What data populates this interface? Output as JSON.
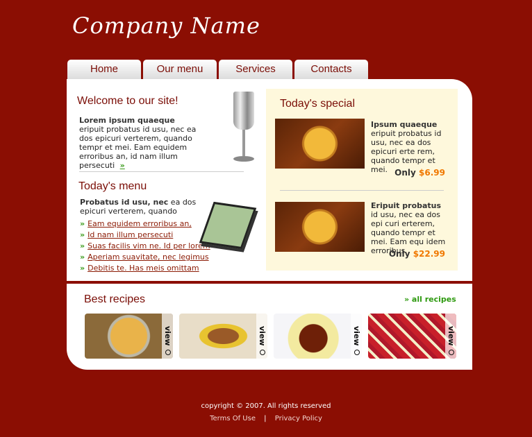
{
  "logo": "Company Name",
  "nav": [
    {
      "label": "Home"
    },
    {
      "label": "Our menu"
    },
    {
      "label": "Services"
    },
    {
      "label": "Contacts"
    }
  ],
  "welcome": {
    "title": "Welcome to our site!",
    "bold": "Lorem ipsum quaeque",
    "text": "eripuit probatus id usu, nec ea dos epicuri verterem, quando tempr et mei. Eam equidem erroribus an, id nam illum persecuti",
    "more": "»"
  },
  "menu": {
    "title": "Today's menu",
    "bold": "Probatus id usu, nec",
    "text": " ea dos epicuri verterem, quando",
    "links": [
      "Eam equidem erroribus an,",
      "Id nam illum persecuti",
      "Suas facilis vim ne. Id per lorem",
      "Aperiam suavitate, nec legimus",
      "Debitis te. Has meis omittam"
    ],
    "bullet": "»"
  },
  "special": {
    "title": "Today's special",
    "items": [
      {
        "name": "Ipsum quaeque",
        "text": "eripuit probatus id usu, nec ea dos epicuri erte rem, quando tempr et mei.",
        "only": "Only",
        "price": "$6.99"
      },
      {
        "name": "Eripuit probatus",
        "text": "id usu, nec ea dos epi curi erterem, quando tempr et mei. Eam equ idem erroribus",
        "only": "Only",
        "price": "$22.99"
      }
    ]
  },
  "recipes": {
    "title": "Best recipes",
    "all": "» all recipes",
    "view": "view",
    "items": [
      "soup",
      "cutlet",
      "glazed-meat",
      "raspberry-tart"
    ]
  },
  "footer": {
    "copyright": "copyright © 2007.  All rights reserved",
    "terms": "Terms Of Use",
    "sep": "|",
    "privacy": "Privacy Policy"
  },
  "colors": {
    "background": "#8b0e03",
    "heading": "#7a0d06",
    "price": "#f07800",
    "link_green": "#3a9a1a",
    "special_bg": "#fef8dc"
  }
}
